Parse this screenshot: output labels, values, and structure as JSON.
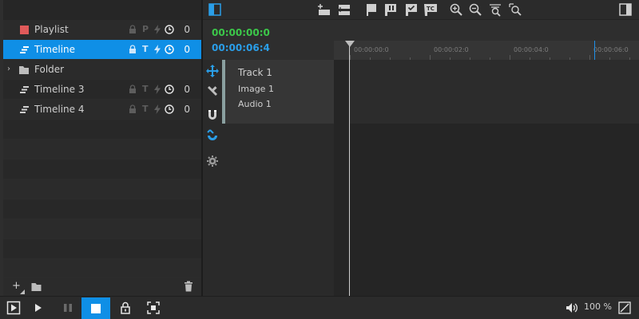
{
  "tree": {
    "items": [
      {
        "label": "Playlist",
        "icon": "playlist-square-icon",
        "icon_color": "#e05a5a",
        "letter": "P",
        "count": "0",
        "expander": ""
      },
      {
        "label": "Timeline",
        "icon": "timeline-icon",
        "letter": "T",
        "count": "0",
        "expander": "",
        "selected": true
      },
      {
        "label": "Folder",
        "icon": "folder-icon",
        "letter": "",
        "count": "",
        "expander": "›"
      },
      {
        "label": "Timeline 3",
        "icon": "timeline-icon",
        "letter": "T",
        "count": "0",
        "expander": ""
      },
      {
        "label": "Timeline 4",
        "icon": "timeline-icon",
        "letter": "T",
        "count": "0",
        "expander": ""
      }
    ]
  },
  "left_footer": {
    "add_label": "+"
  },
  "timecode": {
    "current": "00:00:00:0",
    "duration": "00:00:06:4",
    "current_color": "#3cc84a",
    "duration_color": "#2a9ee8"
  },
  "tracks": [
    "Track 1",
    "Image 1",
    "Audio 1"
  ],
  "ruler": {
    "labels": [
      "00:00:00:0",
      "00:00:02:0",
      "00:00:04:0",
      "00:00:06:0"
    ]
  },
  "status": {
    "zoom": "100 %"
  },
  "colors": {
    "accent": "#0f8fe6",
    "background": "#2b2b2b"
  }
}
